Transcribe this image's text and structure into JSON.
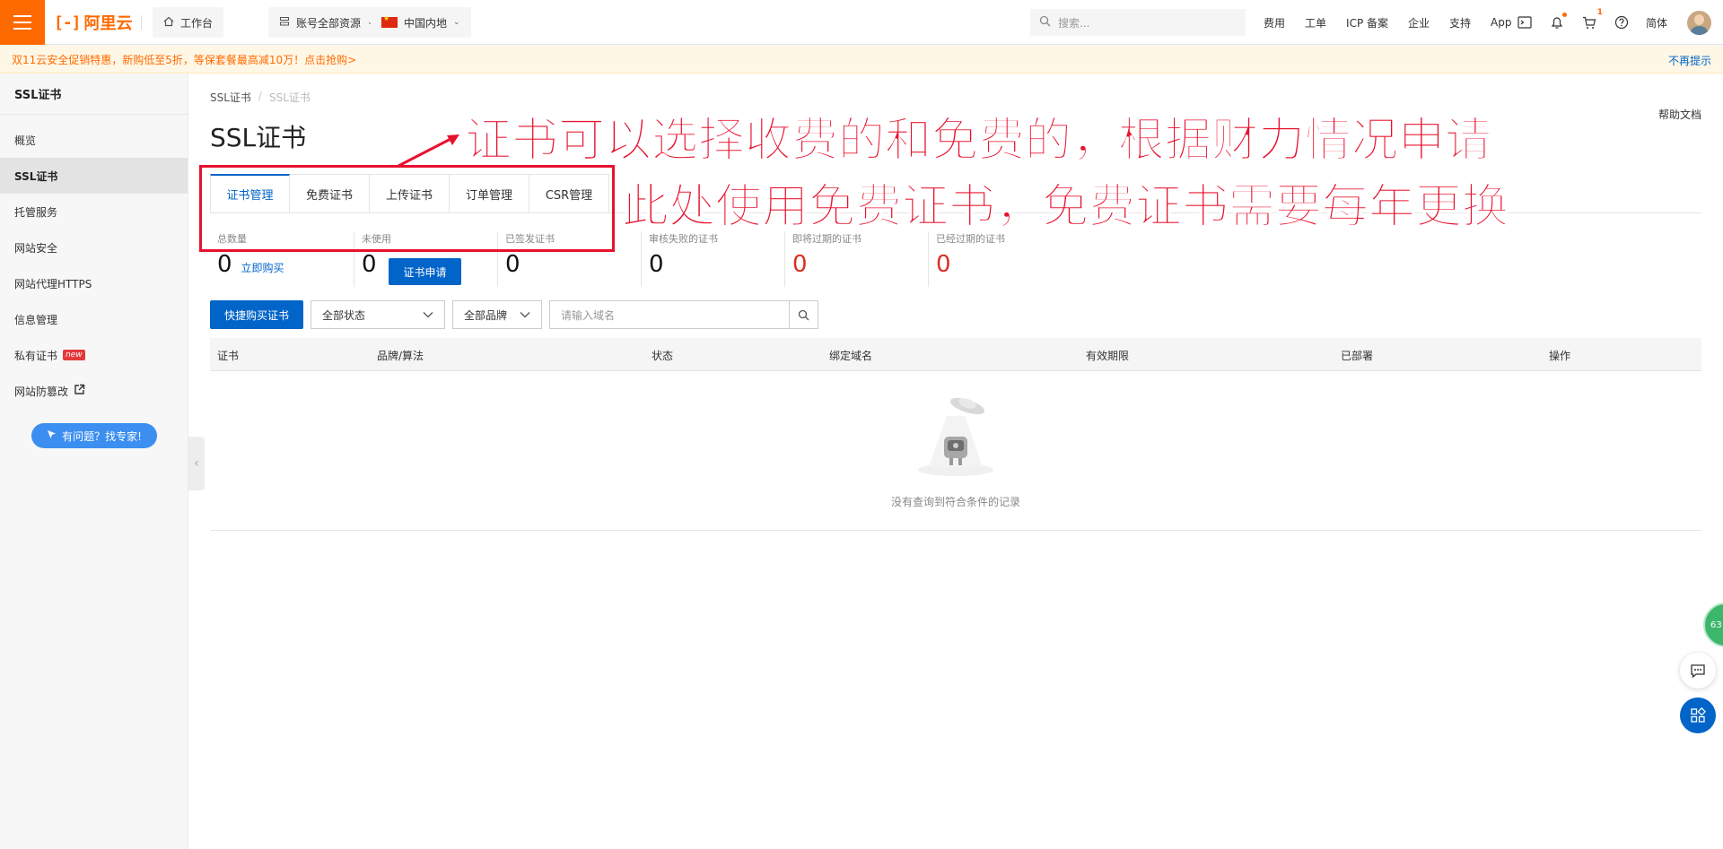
{
  "topbar": {
    "logo_text": "阿里云",
    "workbench": "工作台",
    "resources": "账号全部资源",
    "region": "中国内地",
    "search_placeholder": "搜索...",
    "links": [
      "费用",
      "工单",
      "ICP 备案",
      "企业",
      "支持",
      "App"
    ],
    "cart_badge": "1",
    "lang": "简体"
  },
  "promo": {
    "text": "双11云安全促销特惠，新购低至5折，等保套餐最高减10万！点击抢购>",
    "close": "不再提示"
  },
  "sidebar": {
    "title": "SSL证书",
    "items": [
      {
        "label": "概览"
      },
      {
        "label": "SSL证书"
      },
      {
        "label": "托管服务"
      },
      {
        "label": "网站安全"
      },
      {
        "label": "网站代理HTTPS"
      },
      {
        "label": "信息管理"
      },
      {
        "label": "私有证书",
        "tag": "new"
      },
      {
        "label": "网站防篡改"
      }
    ],
    "help_button": "有问题？找专家!"
  },
  "main": {
    "breadcrumb": [
      "SSL证书",
      "SSL证书"
    ],
    "title": "SSL证书",
    "help_doc": "帮助文档",
    "tabs": [
      "证书管理",
      "免费证书",
      "上传证书",
      "订单管理",
      "CSR管理"
    ],
    "stats": [
      {
        "label": "总数量",
        "value": "0",
        "link": "立即购买"
      },
      {
        "label": "未使用",
        "value": "0",
        "button": "证书申请"
      },
      {
        "label": "已签发证书",
        "value": "0"
      },
      {
        "label": "审核失败的证书",
        "value": "0"
      },
      {
        "label": "即将过期的证书",
        "value": "0"
      },
      {
        "label": "已经过期的证书",
        "value": "0"
      }
    ],
    "toolbar": {
      "buy_button": "快捷购买证书",
      "status_select": "全部状态",
      "brand_select": "全部品牌",
      "domain_placeholder": "请输入域名"
    },
    "table_headers": [
      "证书",
      "品牌/算法",
      "状态",
      "绑定域名",
      "有效期限",
      "已部署",
      "操作"
    ],
    "empty_text": "没有查询到符合条件的记录"
  },
  "annotations": {
    "line1": "证书可以选择收费的和免费的，根据财力情况申请",
    "line2": "此处使用免费证书，免费证书需要每年更换"
  },
  "float": {
    "green_badge": "63"
  },
  "colors": {
    "brand": "#ff6a00",
    "primary": "#0064c8",
    "annotation": "#e8112d",
    "danger": "#d93026"
  }
}
